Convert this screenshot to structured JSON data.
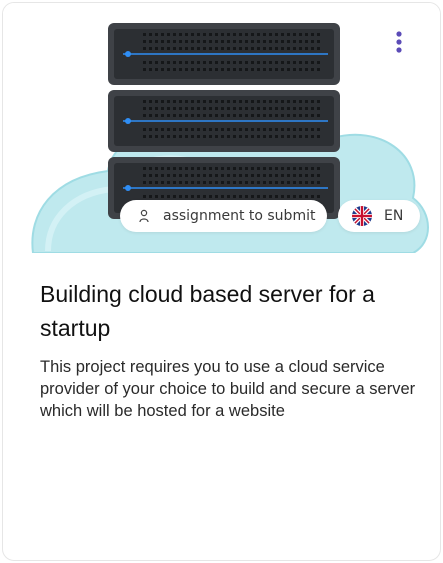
{
  "card": {
    "title": "Building cloud based server for a startup",
    "description": "This project requires you to use a cloud service provider of your choice to build and secure a server which will be hosted for a website",
    "tags": {
      "assignment": "assignment to submit",
      "language": "EN"
    },
    "icons": {
      "menu": "more-vertical-icon",
      "assignment": "person-icon",
      "language": "uk-flag-icon"
    }
  },
  "colors": {
    "menu_dots": "#5b4bb7",
    "cloud": "#bfe9ee",
    "server_body": "#3f4247",
    "server_led": "#2f8ef5"
  }
}
